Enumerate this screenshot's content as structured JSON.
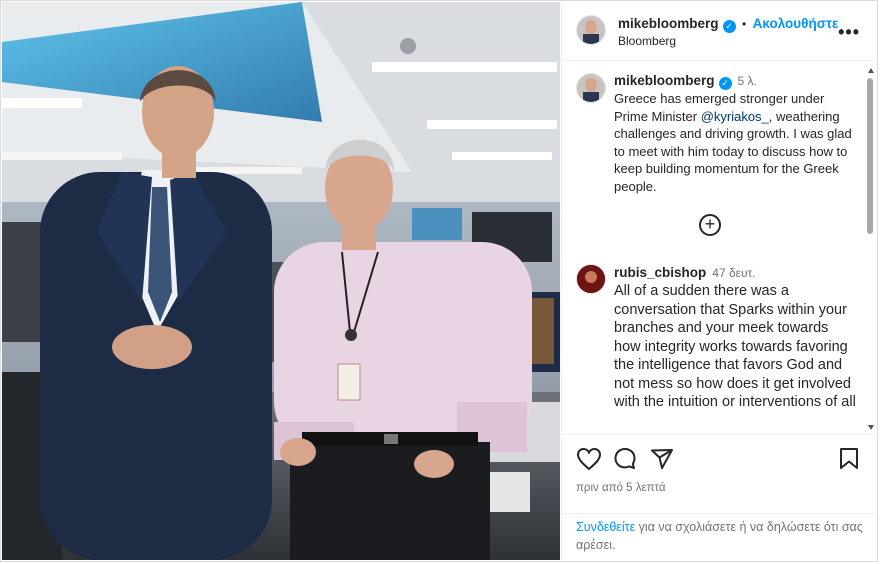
{
  "post_header": {
    "username": "mikebloomberg",
    "separator": "•",
    "follow_label": "Ακολουθήστε",
    "subtitle": "Bloomberg"
  },
  "caption": {
    "username": "mikebloomberg",
    "time": "5 λ.",
    "text_before": "Greece has emerged stronger under Prime Minister ",
    "mention": "@kyriakos_",
    "text_after": ", weathering challenges and driving growth. I was glad to meet with him today to discuss how to keep building momentum for the Greek people."
  },
  "comment": {
    "username": "rubis_cbishop",
    "time": "47 δευτ.",
    "text": "All of a sudden there was a conversation that Sparks within your branches and your meek towards how integrity works towards favoring the intelligence that favors God and not mess so how does it get involved with the intuition or interventions of all"
  },
  "footer": {
    "posted_ago": "πριν από 5 λεπτά",
    "login_link": "Συνδεθείτε",
    "login_text": " για να σχολιάσετε ή να δηλώσετε ότι σας αρέσει."
  },
  "icons": [
    "heart-icon",
    "comment-icon",
    "share-icon",
    "bookmark-icon",
    "more-options-icon",
    "load-more-icon",
    "verified-icon"
  ],
  "colors": {
    "accent": "#0095f6",
    "mention": "#00376b",
    "muted": "#737373"
  }
}
